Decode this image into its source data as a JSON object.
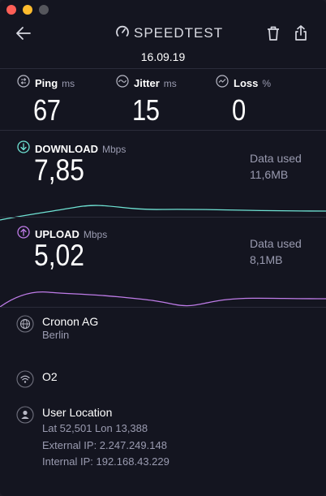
{
  "header": {
    "logo_text": "SPEEDTEST",
    "date": "16.09.19"
  },
  "metrics": [
    {
      "label": "Ping",
      "unit": "ms",
      "value": "67",
      "icon": "ping-icon"
    },
    {
      "label": "Jitter",
      "unit": "ms",
      "value": "15",
      "icon": "jitter-icon"
    },
    {
      "label": "Loss",
      "unit": "%",
      "value": "0",
      "icon": "loss-icon"
    }
  ],
  "download": {
    "label": "DOWNLOAD",
    "unit": "Mbps",
    "value": "7,85",
    "data_used_label": "Data used",
    "data_used_value": "11,6MB",
    "color": "#6fe3d4"
  },
  "upload": {
    "label": "UPLOAD",
    "unit": "Mbps",
    "value": "5,02",
    "data_used_label": "Data used",
    "data_used_value": "8,1MB",
    "color": "#bf7ce8"
  },
  "server": {
    "name": "Cronon AG",
    "city": "Berlin"
  },
  "provider": {
    "name": "O2"
  },
  "user_location": {
    "title": "User Location",
    "coords": "Lat 52,501 Lon 13,388",
    "external_ip": "External IP: 2.247.249.148",
    "internal_ip": "Internal IP: 192.168.43.229"
  },
  "colors": {
    "background": "#141520",
    "accent_download": "#6fe3d4",
    "accent_upload": "#bf7ce8",
    "muted_text": "#9a9bb0"
  }
}
